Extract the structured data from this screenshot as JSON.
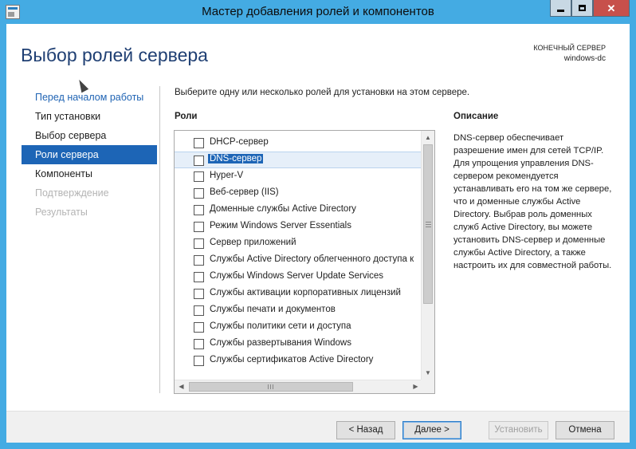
{
  "window": {
    "title": "Мастер добавления ролей и компонентов",
    "min_icon": "minimize-icon",
    "max_icon": "maximize-icon",
    "close_icon": "close-icon"
  },
  "page": {
    "heading": "Выбор ролей сервера",
    "destination_label": "КОНЕЧНЫЙ СЕРВЕР",
    "destination_name": "windows-dc"
  },
  "nav": {
    "items": [
      {
        "label": "Перед началом работы",
        "state": "link"
      },
      {
        "label": "Тип установки",
        "state": "normal"
      },
      {
        "label": "Выбор сервера",
        "state": "normal"
      },
      {
        "label": "Роли сервера",
        "state": "active"
      },
      {
        "label": "Компоненты",
        "state": "normal"
      },
      {
        "label": "Подтверждение",
        "state": "disabled"
      },
      {
        "label": "Результаты",
        "state": "disabled"
      }
    ]
  },
  "main": {
    "instruction": "Выберите одну или несколько ролей для установки на этом сервере.",
    "roles_title": "Роли",
    "roles": [
      {
        "label": "DHCP-сервер",
        "checked": false
      },
      {
        "label": "DNS-сервер",
        "checked": false,
        "selected": true
      },
      {
        "label": "Hyper-V",
        "checked": false
      },
      {
        "label": "Веб-сервер (IIS)",
        "checked": false
      },
      {
        "label": "Доменные службы Active Directory",
        "checked": false
      },
      {
        "label": "Режим Windows Server Essentials",
        "checked": false
      },
      {
        "label": "Сервер приложений",
        "checked": false
      },
      {
        "label": "Службы Active Directory облегченного доступа к",
        "checked": false
      },
      {
        "label": "Службы Windows Server Update Services",
        "checked": false
      },
      {
        "label": "Службы активации корпоративных лицензий",
        "checked": false
      },
      {
        "label": "Службы печати и документов",
        "checked": false
      },
      {
        "label": "Службы политики сети и доступа",
        "checked": false
      },
      {
        "label": "Службы развертывания Windows",
        "checked": false
      },
      {
        "label": "Службы сертификатов Active Directory",
        "checked": false
      }
    ],
    "description_title": "Описание",
    "description_text": "DNS-сервер обеспечивает разрешение имен для сетей TCP/IP. Для упрощения управления DNS-сервером рекомендуется устанавливать его на том же сервере, что и доменные службы Active Directory. Выбрав роль доменных служб Active Directory, вы можете установить DNS-сервер и доменные службы Active Directory, а также настроить их для совместной работы."
  },
  "footer": {
    "back_label": "< Назад",
    "next_label": "Далее >",
    "install_label": "Установить",
    "cancel_label": "Отмена"
  }
}
